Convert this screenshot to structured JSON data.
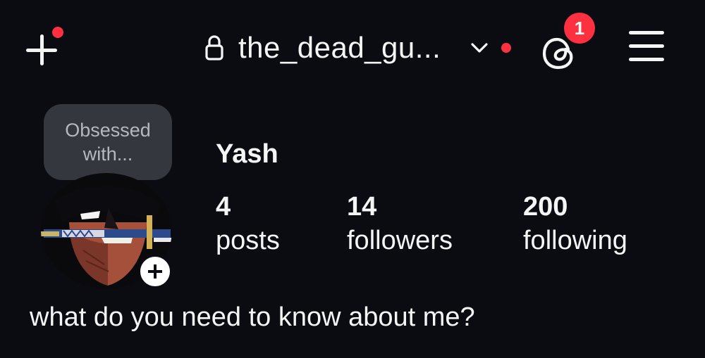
{
  "header": {
    "username": "the_dead_gu...",
    "threads_badge_count": "1"
  },
  "note": {
    "line1": "Obsessed",
    "line2": "with..."
  },
  "profile": {
    "display_name": "Yash",
    "bio": "what do you need to know about me?"
  },
  "stats": {
    "posts": {
      "value": "4",
      "label": "posts"
    },
    "followers": {
      "value": "14",
      "label": "followers"
    },
    "following": {
      "value": "200",
      "label": "following"
    }
  },
  "colors": {
    "background": "#0b0c12",
    "text": "#f5f5f5",
    "notification_red": "#ff3040",
    "note_bubble": "#34373d"
  },
  "icons": {
    "create": "plus-icon",
    "lock": "lock-icon",
    "account_dropdown": "chevron-down-icon",
    "threads": "threads-icon",
    "menu": "hamburger-menu-icon",
    "add_story": "plus-icon"
  }
}
